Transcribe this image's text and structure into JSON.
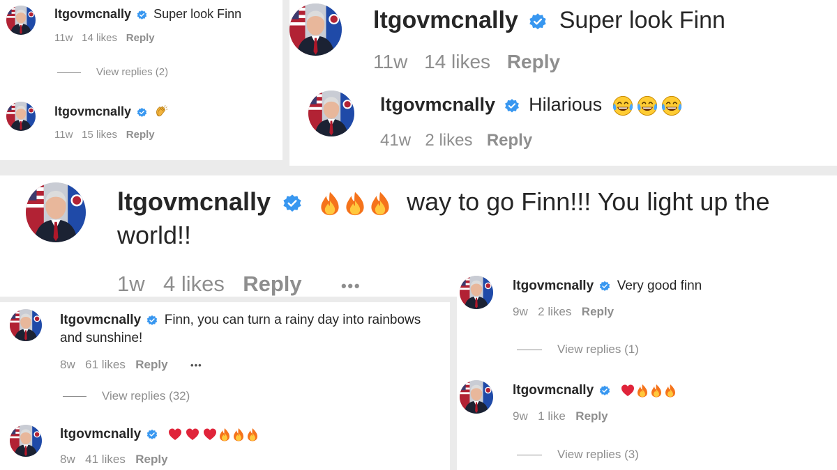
{
  "user": {
    "username": "ltgovmcnally",
    "verified_icon": "verified-badge-icon",
    "badge_color": "#3897f0"
  },
  "comments": [
    {
      "text": "Super look Finn",
      "time": "11w",
      "likes": "14 likes",
      "reply": "Reply",
      "view_replies": "View replies (2)"
    },
    {
      "text": "",
      "emojis": [
        "clapping-hands-emoji"
      ],
      "time": "11w",
      "likes": "15 likes",
      "reply": "Reply"
    },
    {
      "text": "Super look Finn",
      "time": "11w",
      "likes": "14 likes",
      "reply": "Reply"
    },
    {
      "text": "Hilarious",
      "emojis": [
        "tears-of-joy-emoji",
        "tears-of-joy-emoji",
        "tears-of-joy-emoji"
      ],
      "time": "41w",
      "likes": "2 likes",
      "reply": "Reply"
    },
    {
      "emojis": [
        "fire-emoji",
        "fire-emoji",
        "fire-emoji"
      ],
      "text_line1": "way to go Finn!!! You light up the",
      "text_line2": "world!!",
      "time": "1w",
      "likes": "4 likes",
      "reply": "Reply",
      "more": "•••"
    },
    {
      "text": "Very good finn",
      "time": "9w",
      "likes": "2 likes",
      "reply": "Reply",
      "view_replies": "View replies (1)"
    },
    {
      "text_line1": "Finn, you can turn a rainy day into rainbows",
      "text_line2": "and sunshine!",
      "time": "8w",
      "likes": "61 likes",
      "reply": "Reply",
      "more": "•••",
      "view_replies": "View replies (32)"
    },
    {
      "emojis": [
        "red-heart-emoji",
        "fire-emoji",
        "fire-emoji",
        "fire-emoji"
      ],
      "time": "9w",
      "likes": "1 like",
      "reply": "Reply",
      "view_replies": "View replies (3)"
    },
    {
      "emojis": [
        "red-heart-emoji",
        "red-heart-emoji",
        "red-heart-emoji",
        "fire-emoji",
        "fire-emoji",
        "fire-emoji"
      ],
      "time": "8w",
      "likes": "41 likes",
      "reply": "Reply"
    }
  ]
}
